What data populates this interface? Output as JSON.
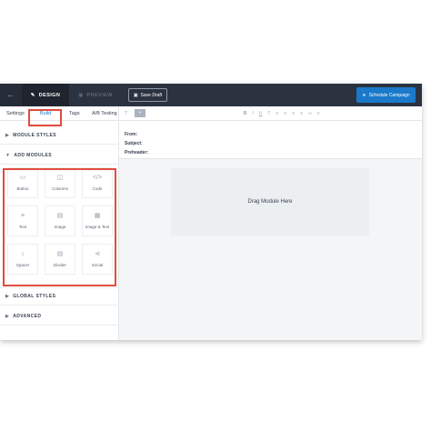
{
  "topbar": {
    "back_icon": "arrow-left-icon",
    "design_label": "DESIGN",
    "preview_label": "PREVIEW",
    "save_draft_label": "Save Draft",
    "schedule_label": "Schedule Campaign"
  },
  "sidebar": {
    "tabs": [
      "Settings",
      "Build",
      "Tags",
      "A/B Testing"
    ],
    "sections": {
      "module_styles": "MODULE STYLES",
      "add_modules": "ADD MODULES",
      "global_styles": "GLOBAL STYLES",
      "advanced": "ADVANCED"
    },
    "modules": [
      {
        "label": "Button",
        "icon": "button-icon"
      },
      {
        "label": "Columns",
        "icon": "columns-icon"
      },
      {
        "label": "Code",
        "icon": "code-icon"
      },
      {
        "label": "Text",
        "icon": "text-icon"
      },
      {
        "label": "Image",
        "icon": "image-icon"
      },
      {
        "label": "Image & Text",
        "icon": "image-text-icon"
      },
      {
        "label": "Spacer",
        "icon": "spacer-icon"
      },
      {
        "label": "Divider",
        "icon": "divider-icon"
      },
      {
        "label": "Social",
        "icon": "social-icon"
      }
    ]
  },
  "main": {
    "fields": {
      "from": "From:",
      "subject": "Subject:",
      "preheader": "Preheader:"
    },
    "dropzone_label": "Drag Module Here"
  },
  "colors": {
    "topbar": "#2c3340",
    "primary_button": "#1a79c9",
    "highlight": "#e04b3f"
  }
}
